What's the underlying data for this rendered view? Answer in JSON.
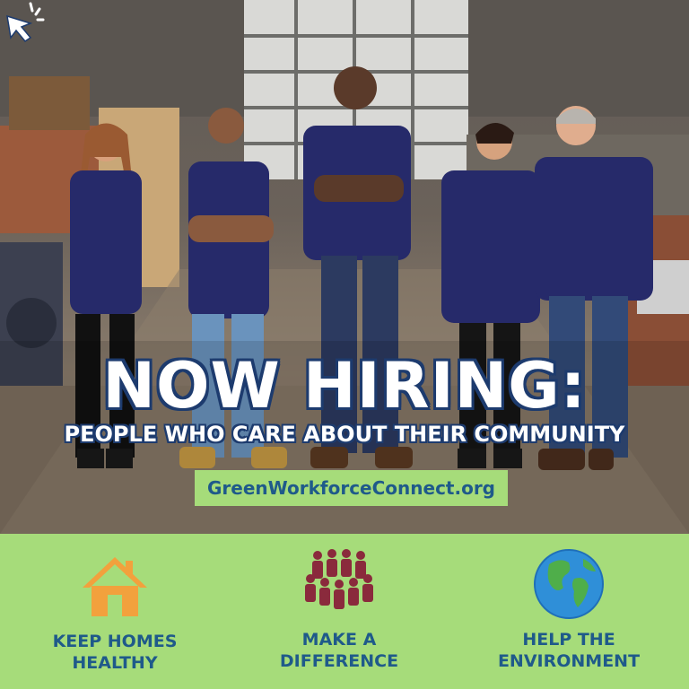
{
  "headline": "NOW HIRING:",
  "subheadline": "PEOPLE WHO CARE ABOUT THEIR COMMUNITY",
  "website": "GreenWorkforceConnect.org",
  "features": [
    {
      "icon": "house-icon",
      "line1": "KEEP HOMES",
      "line2": "HEALTHY"
    },
    {
      "icon": "people-group-icon",
      "line1": "MAKE A",
      "line2": "DIFFERENCE"
    },
    {
      "icon": "globe-icon",
      "line1": "HELP THE",
      "line2": "ENVIRONMENT"
    }
  ],
  "colors": {
    "panel_green": "#a6dc7a",
    "text_blue": "#1f5a8a",
    "outline_navy": "#1d3b6e",
    "house_orange": "#f2a13d",
    "people_maroon": "#8a2a3c"
  }
}
